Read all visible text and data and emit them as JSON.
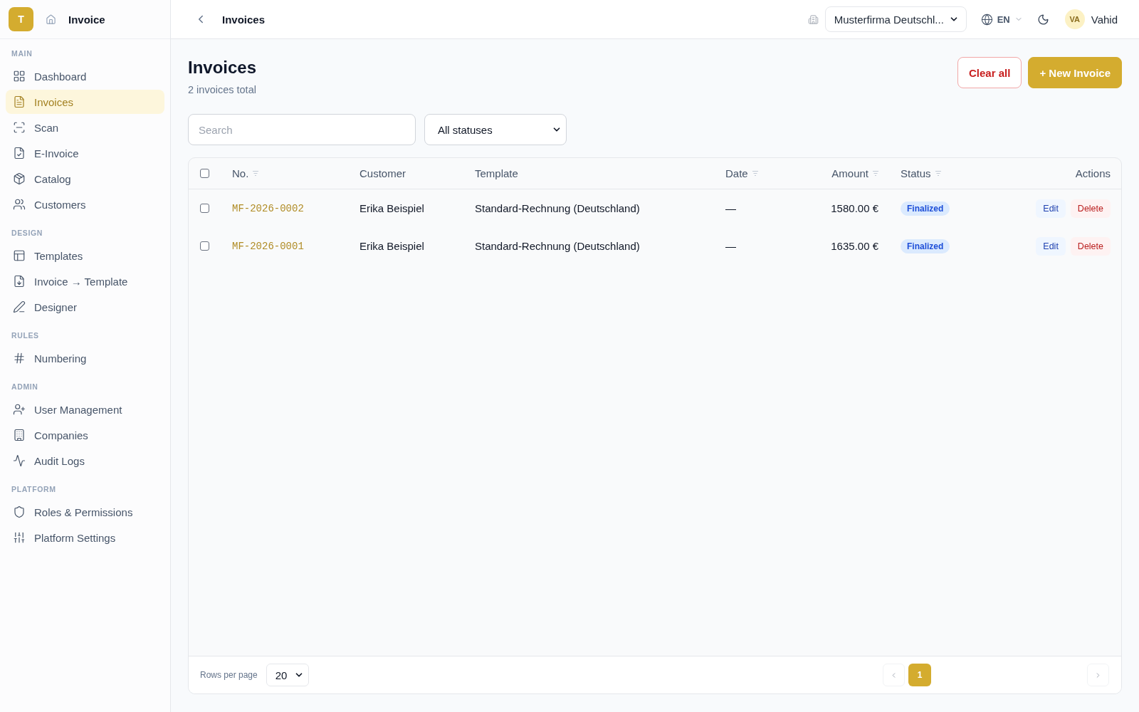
{
  "sidebar": {
    "logo": "T",
    "title": "Invoice",
    "sections": [
      {
        "label": "MAIN",
        "items": [
          {
            "label": "Dashboard",
            "selected": false
          },
          {
            "label": "Invoices",
            "selected": true
          },
          {
            "label": "Scan",
            "selected": false
          },
          {
            "label": "E-Invoice",
            "selected": false
          },
          {
            "label": "Catalog",
            "selected": false
          },
          {
            "label": "Customers",
            "selected": false
          }
        ]
      },
      {
        "label": "DESIGN",
        "items": [
          {
            "label": "Templates",
            "selected": false
          },
          {
            "label": "Invoice → Template",
            "selected": false
          },
          {
            "label": "Designer",
            "selected": false
          }
        ]
      },
      {
        "label": "RULES",
        "items": [
          {
            "label": "Numbering",
            "selected": false
          }
        ]
      },
      {
        "label": "ADMIN",
        "items": [
          {
            "label": "User Management",
            "selected": false
          },
          {
            "label": "Companies",
            "selected": false
          },
          {
            "label": "Audit Logs",
            "selected": false
          }
        ]
      },
      {
        "label": "PLATFORM",
        "items": [
          {
            "label": "Roles & Permissions",
            "selected": false
          },
          {
            "label": "Platform Settings",
            "selected": false
          }
        ]
      }
    ]
  },
  "topbar": {
    "title": "Invoices",
    "company_select": {
      "value": "Musterfirma Deutschl..."
    },
    "language": "EN",
    "user": {
      "initials": "VA",
      "name": "Vahid"
    }
  },
  "header": {
    "title": "Invoices",
    "subtitle": "2 invoices total",
    "buttons": [
      {
        "label": "Clear all",
        "kind": "outline"
      },
      {
        "label": "+ New Invoice",
        "kind": "primary"
      }
    ]
  },
  "filters": {
    "search": {
      "placeholder": "Search"
    },
    "status_select": {
      "value": "All statuses"
    }
  },
  "table": {
    "select_all": {
      "checked": false
    },
    "columns": [
      {
        "label": "No.",
        "sortable": true
      },
      {
        "label": "Customer",
        "sortable": false
      },
      {
        "label": "Template",
        "sortable": false
      },
      {
        "label": "Date",
        "sortable": true
      },
      {
        "label": "Amount",
        "sortable": true
      },
      {
        "label": "Status",
        "sortable": true
      },
      {
        "label": "Actions",
        "sortable": false
      }
    ],
    "rows": [
      {
        "checked": false,
        "number": "MF-2026-0002",
        "customer": "Erika Beispiel",
        "template": "Standard-Rechnung (Deutschland)",
        "date": "—",
        "amount": "1580.00 €",
        "status": "Finalized",
        "actions": [
          {
            "label": "Edit",
            "kind": "edit"
          },
          {
            "label": "Delete",
            "kind": "delete"
          }
        ]
      },
      {
        "checked": false,
        "number": "MF-2026-0001",
        "customer": "Erika Beispiel",
        "template": "Standard-Rechnung (Deutschland)",
        "date": "—",
        "amount": "1635.00 €",
        "status": "Finalized",
        "actions": [
          {
            "label": "Edit",
            "kind": "edit"
          },
          {
            "label": "Delete",
            "kind": "delete"
          }
        ]
      }
    ]
  },
  "pagination": {
    "rows_per_page_label": "Rows per page",
    "rows_per_page": "20",
    "pages": [
      {
        "label": "1",
        "selected": true
      }
    ]
  }
}
